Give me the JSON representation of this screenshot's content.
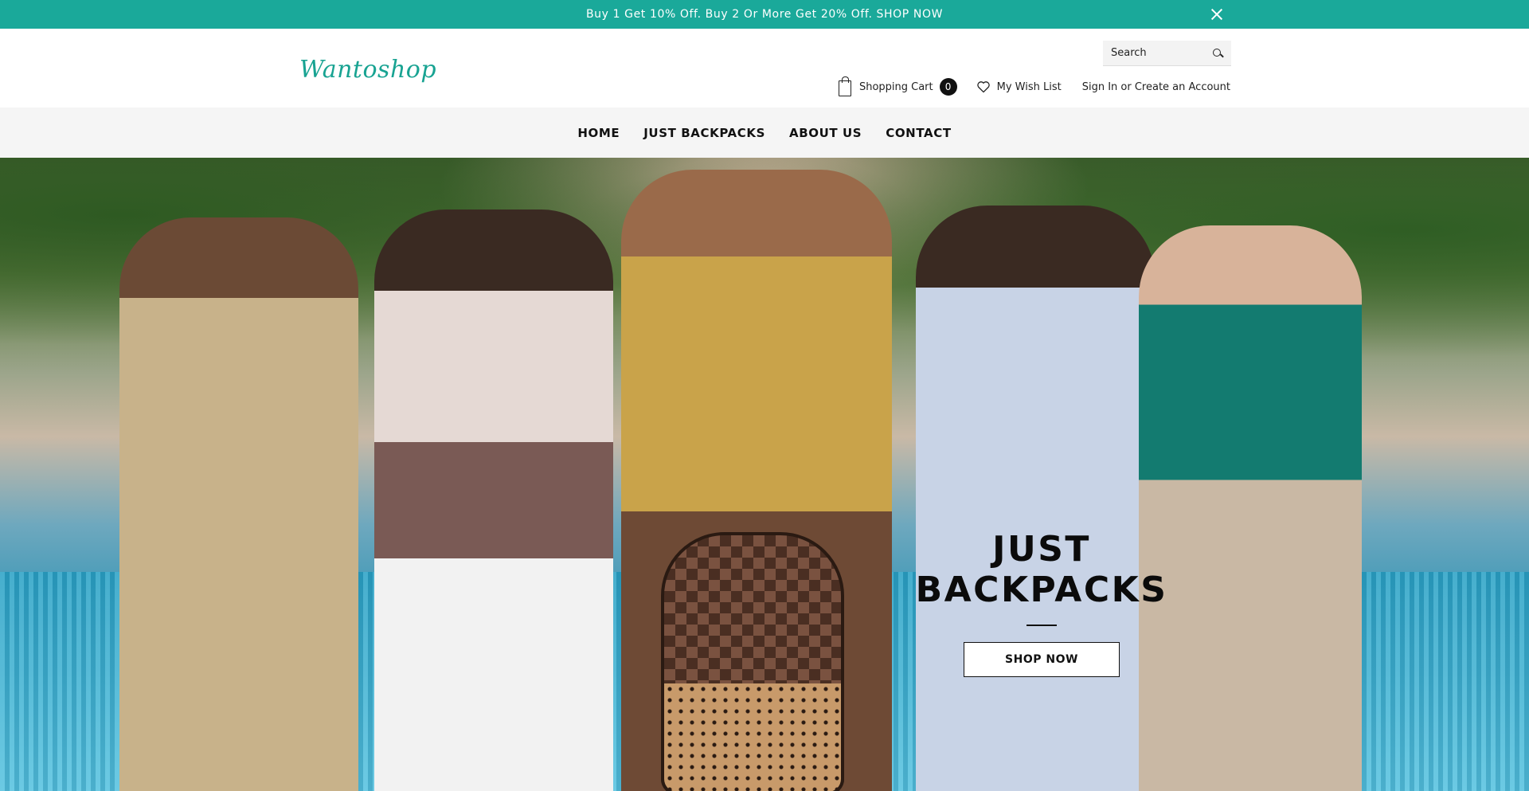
{
  "announcement": {
    "text": "Buy 1 Get 10% Off. Buy 2 Or More Get 20% Off. SHOP NOW",
    "background": "#1aa99a"
  },
  "header": {
    "logo": "Wantoshop",
    "search_placeholder": "Search",
    "cart_label": "Shopping Cart",
    "cart_count": "0",
    "wishlist_label": "My Wish List",
    "account_label": "Sign In or Create an Account"
  },
  "nav": {
    "items": [
      {
        "label": "HOME"
      },
      {
        "label": "JUST BACKPACKS"
      },
      {
        "label": "ABOUT US"
      },
      {
        "label": "CONTACT"
      }
    ]
  },
  "hero": {
    "title": "JUST BACKPACKS",
    "button_label": "SHOP NOW"
  }
}
